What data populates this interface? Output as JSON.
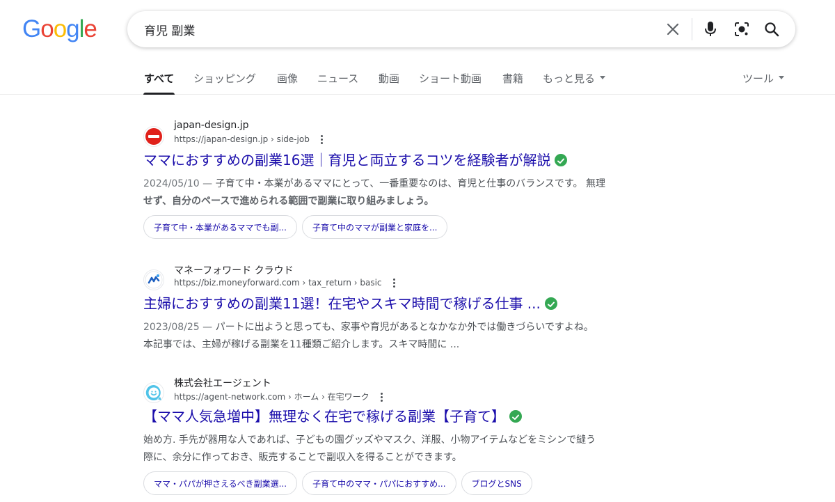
{
  "logo": {
    "letters": [
      "G",
      "o",
      "o",
      "g",
      "l",
      "e"
    ],
    "colors": [
      "#4285F4",
      "#EA4335",
      "#FBBC05",
      "#4285F4",
      "#34A853",
      "#EA4335"
    ]
  },
  "search": {
    "query": "育児 副業",
    "icons": [
      "close-icon",
      "mic-icon",
      "lens-icon",
      "search-icon"
    ]
  },
  "tabs": {
    "items": [
      "すべて",
      "ショッピング",
      "画像",
      "ニュース",
      "動画",
      "ショート動画",
      "書籍",
      "もっと見る"
    ],
    "tools": "ツール",
    "active": "すべて"
  },
  "results": [
    {
      "site_name": "japan-design.jp",
      "url": "https://japan-design.jp › side-job",
      "title": "ママにおすすめの副業16選｜育児と両立するコツを経験者が解説",
      "date": "2024/05/10 — ",
      "snippet_line1": "子育て中・本業があるママにとって、一番重要なのは、育児と仕事のバランスです。 無理",
      "snippet_line2": "せず、自分のペースで進められる範囲で副業に取り組みましょう。",
      "chips": [
        "子育て中・本業があるママでも副...",
        "子育て中のママが副業と家庭を..."
      ],
      "verified": true,
      "favicon": "no-entry-icon"
    },
    {
      "site_name": "マネーフォワード クラウド",
      "url": "https://biz.moneyforward.com › tax_return › basic",
      "title": "主婦におすすめの副業11選！在宅やスキマ時間で稼げる仕事 ...",
      "date": "2023/08/25 — ",
      "snippet_line1": "パートに出ようと思っても、家事や育児があるとなかなか外では働きづらいですよね。",
      "snippet_line2": "本記事では、主婦が稼げる副業を11種類ご紹介します。スキマ時間に ...",
      "chips": [],
      "verified": true,
      "favicon": "moneyforward-logo-icon"
    },
    {
      "site_name": "株式会社エージェント",
      "url": "https://agent-network.com › ホーム › 在宅ワーク",
      "title": "【ママ人気急増中】無理なく在宅で稼げる副業【子育て】",
      "date": "",
      "snippet_line1": "始め方. 手先が器用な人であれば、子どもの園グッズやマスク、洋服、小物アイテムなどをミシンで縫う",
      "snippet_line2": "際に、余分に作っておき、販売することで副収入を得ることができます。",
      "chips": [
        "ママ・パパが押さえるべき副業選...",
        "子育て中のママ・パパにおすすめ...",
        "ブログとSNS"
      ],
      "verified": true,
      "favicon": "smile-chat-icon"
    }
  ]
}
